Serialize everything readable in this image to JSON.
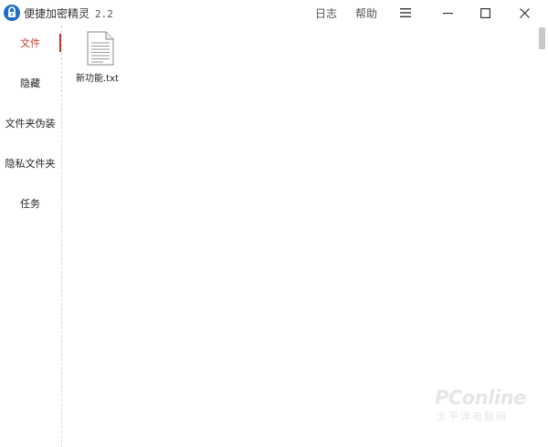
{
  "window": {
    "title": "便捷加密精灵",
    "version": "2.2",
    "menu": {
      "log": "日志",
      "help": "帮助"
    },
    "icons": {
      "app": "padlock-icon",
      "menu": "hamburger-icon",
      "minimize": "minimize-icon",
      "maximize": "maximize-icon",
      "close": "close-icon"
    }
  },
  "sidebar": {
    "active_index": 0,
    "accent_color": "#c0392b",
    "items": [
      {
        "label": "文件"
      },
      {
        "label": "隐藏"
      },
      {
        "label": "文件夹伪装"
      },
      {
        "label": "隐私文件夹"
      },
      {
        "label": "任务"
      }
    ]
  },
  "content": {
    "files": [
      {
        "name": "新功能.txt",
        "icon": "text-file-icon"
      }
    ]
  },
  "watermark": {
    "main": "PConline",
    "sub": "太平洋电脑网"
  }
}
